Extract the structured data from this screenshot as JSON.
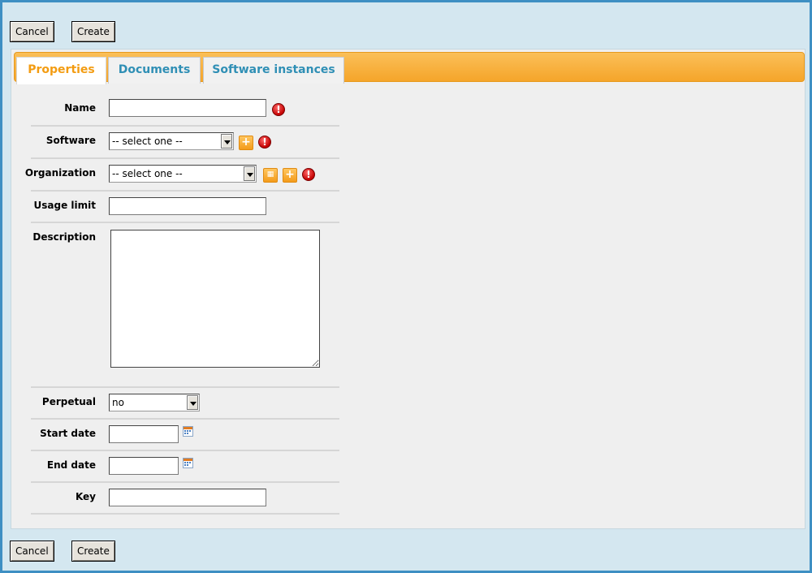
{
  "actions": {
    "cancel_label": "Cancel",
    "create_label": "Create"
  },
  "tabs": [
    {
      "label": "Properties",
      "active": true
    },
    {
      "label": "Documents",
      "active": false
    },
    {
      "label": "Software instances",
      "active": false
    }
  ],
  "form": {
    "name": {
      "label": "Name",
      "value": ""
    },
    "software": {
      "label": "Software",
      "selected": "-- select one --"
    },
    "organization": {
      "label": "Organization",
      "selected": "-- select one --"
    },
    "usage_limit": {
      "label": "Usage limit",
      "value": ""
    },
    "description": {
      "label": "Description",
      "value": ""
    },
    "perpetual": {
      "label": "Perpetual",
      "selected": "no"
    },
    "start_date": {
      "label": "Start date",
      "value": ""
    },
    "end_date": {
      "label": "End date",
      "value": ""
    },
    "key": {
      "label": "Key",
      "value": ""
    }
  },
  "icons": {
    "plus": "+",
    "warning": "!"
  },
  "colors": {
    "tab_bar": "#f5a52a",
    "active_tab_text": "#f39c12",
    "tab_text": "#2f8fb5",
    "warning": "#c40000"
  }
}
